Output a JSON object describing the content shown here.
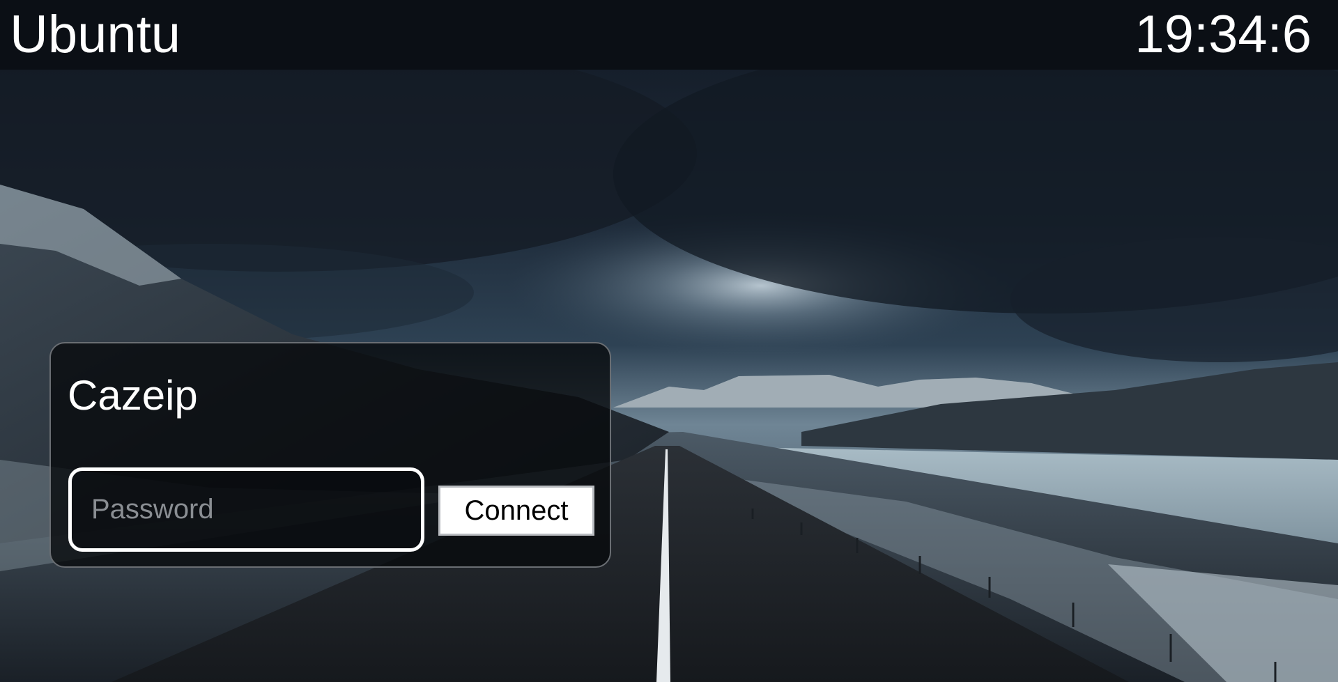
{
  "topbar": {
    "os_name": "Ubuntu",
    "clock": "19:34:6"
  },
  "login": {
    "username": "Cazeip",
    "password_value": "",
    "password_placeholder": "Password",
    "connect_label": "Connect"
  },
  "wallpaper": {
    "description_icon": "landscape-road-icon"
  },
  "colors": {
    "topbar_bg": "#0b0f15",
    "panel_bg": "#080a0d",
    "panel_border": "#6a6e73",
    "text": "#ffffff",
    "button_bg": "#ffffff",
    "button_text": "#000000"
  }
}
